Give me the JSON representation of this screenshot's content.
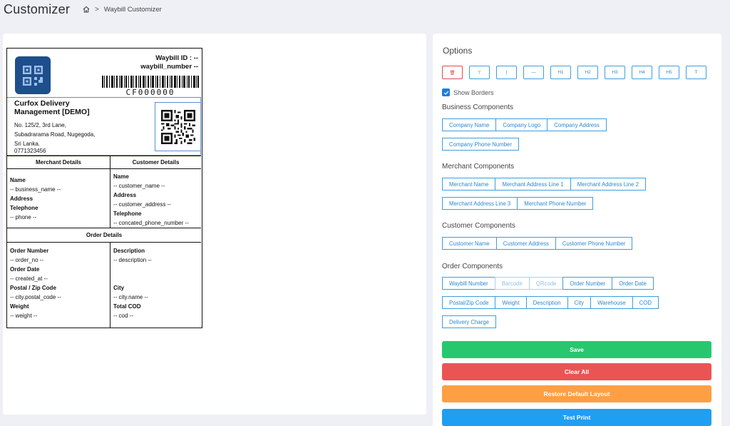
{
  "header": {
    "title": "Customizer",
    "breadcrumb": {
      "home_icon": "home-icon",
      "separator": ">",
      "current": "Waybill Customizer"
    }
  },
  "waybill": {
    "id_line1": "Waybill ID : --",
    "id_line2": "waybill_number --",
    "barcode_number": "CF000000",
    "company_name": "Curfox Delivery Management [DEMO]",
    "company_address": "No. 125/2, 3rd Lane, Subadrarama Road, Nugegoda, Sri Lanka.",
    "company_phone": "0771323456",
    "merchant_details_title": "Merchant Details",
    "customer_details_title": "Customer Details",
    "merchant": {
      "name_label": "Name",
      "name_value": "-- business_name --",
      "address_label": "Address",
      "telephone_label": "Telephone",
      "phone_value": "-- phone --"
    },
    "customer": {
      "name_label": "Name",
      "name_value": "-- customer_name --",
      "address_label": "Address",
      "address_value": "-- customer_address --",
      "telephone_label": "Telephone",
      "phone_value": "-- concated_phone_number --"
    },
    "order_details_title": "Order Details",
    "order": {
      "order_number_label": "Order Number",
      "order_number_value": "-- order_no --",
      "order_date_label": "Order Date",
      "order_date_value": "-- created_at --",
      "postal_label": "Postal / Zip Code",
      "postal_value": "-- city.postal_code --",
      "weight_label": "Weight",
      "weight_value": "-- weight --",
      "description_label": "Description",
      "description_value": "-- description --",
      "city_label": "City",
      "city_value": "-- city.name --",
      "total_cod_label": "Total COD",
      "cod_value": "-- cod --"
    }
  },
  "options": {
    "title": "Options",
    "toolbar": [
      {
        "icon": "delete-icon",
        "label": "🗑"
      },
      {
        "icon": "table-icon",
        "label": "⊤"
      },
      {
        "icon": "vertical-line-icon",
        "label": "|"
      },
      {
        "icon": "horizontal-line-icon",
        "label": "—"
      },
      {
        "icon": "h1-icon",
        "label": "H1"
      },
      {
        "icon": "h2-icon",
        "label": "H2"
      },
      {
        "icon": "h3-icon",
        "label": "H3"
      },
      {
        "icon": "h4-icon",
        "label": "H4"
      },
      {
        "icon": "h5-icon",
        "label": "H5"
      },
      {
        "icon": "text-icon",
        "label": "T"
      }
    ],
    "show_borders_label": "Show Borders",
    "show_borders_checked": true,
    "business_title": "Business Components",
    "business_row1": [
      "Company Name",
      "Company Logo",
      "Company Address"
    ],
    "business_row2": [
      "Company Phone Number"
    ],
    "merchant_title": "Merchant Components",
    "merchant_row1": [
      "Merchant Name",
      "Merchant Address Line 1",
      "Merchant Address Line 2"
    ],
    "merchant_row2": [
      "Merchant Address Line 3",
      "Merchant Phone Number"
    ],
    "customer_title": "Customer Components",
    "customer_row1": [
      "Customer Name",
      "Customer Address",
      "Customer Phone Number"
    ],
    "order_title": "Order Components",
    "order_row1": [
      "Waybill Number",
      "Barcode",
      "QRcode",
      "Order Number",
      "Order Date"
    ],
    "order_row2": [
      "Postal/Zip Code",
      "Weight",
      "Description",
      "City",
      "Warehouse",
      "COD"
    ],
    "order_row3": [
      "Delivery Charge"
    ],
    "save_label": "Save",
    "clear_label": "Clear All",
    "restore_label": "Restore Default Layout",
    "test_print_label": "Test Print",
    "colors": {
      "save": "#28c76f",
      "clear": "#ea5455",
      "restore": "#ff9f43",
      "print": "#1e9ff2",
      "accent": "#2a8ad4"
    }
  }
}
